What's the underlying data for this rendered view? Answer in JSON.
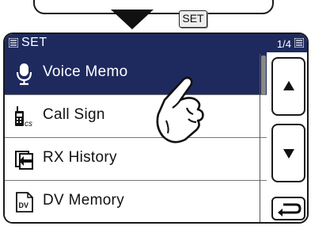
{
  "indicator": {
    "key_label": "SET"
  },
  "titlebar": {
    "title": "SET",
    "page": "1/4"
  },
  "menu": {
    "items": [
      {
        "label": "Voice Memo",
        "icon": "microphone-icon",
        "selected": true
      },
      {
        "label": "Call Sign",
        "icon": "call-sign-icon",
        "selected": false
      },
      {
        "label": "RX History",
        "icon": "rx-history-icon",
        "selected": false
      },
      {
        "label": "DV Memory",
        "icon": "dv-memory-icon",
        "selected": false
      }
    ]
  },
  "buttons": {
    "up": "up-arrow-icon",
    "down": "down-arrow-icon",
    "back": "return-icon"
  },
  "colors": {
    "highlight": "#1e2a5e",
    "border": "#1a1a1a"
  }
}
